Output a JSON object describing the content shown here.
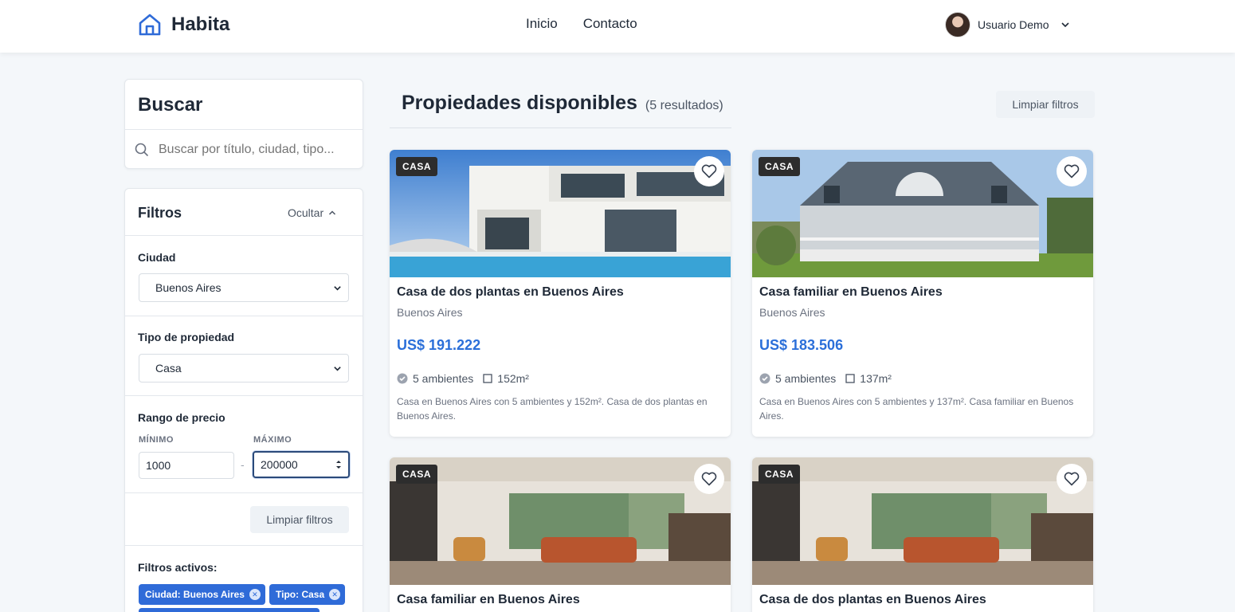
{
  "header": {
    "brand": "Habita",
    "nav": [
      "Inicio",
      "Contacto"
    ],
    "user_name": "Usuario Demo"
  },
  "search": {
    "title": "Buscar",
    "placeholder": "Buscar por título, ciudad, tipo..."
  },
  "filters": {
    "title": "Filtros",
    "toggle_label": "Ocultar",
    "city_label": "Ciudad",
    "city_value": "Buenos Aires",
    "type_label": "Tipo de propiedad",
    "type_value": "Casa",
    "price_label": "Rango de precio",
    "min_label": "MÍNIMO",
    "max_label": "MÁXIMO",
    "min_value": "1000",
    "max_value": "200000",
    "separator": "-",
    "clear_label": "Limpiar filtros",
    "active_label": "Filtros activos:",
    "active_chips": [
      "Ciudad: Buenos Aires",
      "Tipo: Casa"
    ]
  },
  "main": {
    "title": "Propiedades disponibles",
    "count": "(5 resultados)",
    "clear_label": "Limpiar filtros"
  },
  "cards": [
    {
      "badge": "CASA",
      "title": "Casa de dos plantas en Buenos Aires",
      "city": "Buenos Aires",
      "price": "US$ 191.222",
      "rooms": "5 ambientes",
      "area": "152m²",
      "description": "Casa en Buenos Aires con 5 ambientes y 152m². Casa de dos plantas en Buenos Aires."
    },
    {
      "badge": "CASA",
      "title": "Casa familiar en Buenos Aires",
      "city": "Buenos Aires",
      "price": "US$ 183.506",
      "rooms": "5 ambientes",
      "area": "137m²",
      "description": "Casa en Buenos Aires con 5 ambientes y 137m². Casa familiar en Buenos Aires."
    },
    {
      "badge": "CASA",
      "title": "Casa familiar en Buenos Aires"
    },
    {
      "badge": "CASA",
      "title": "Casa de dos plantas en Buenos Aires"
    }
  ],
  "colors": {
    "accent": "#2b6fd9",
    "chip": "#2f6bd8",
    "badge": "#2d2d2d"
  }
}
